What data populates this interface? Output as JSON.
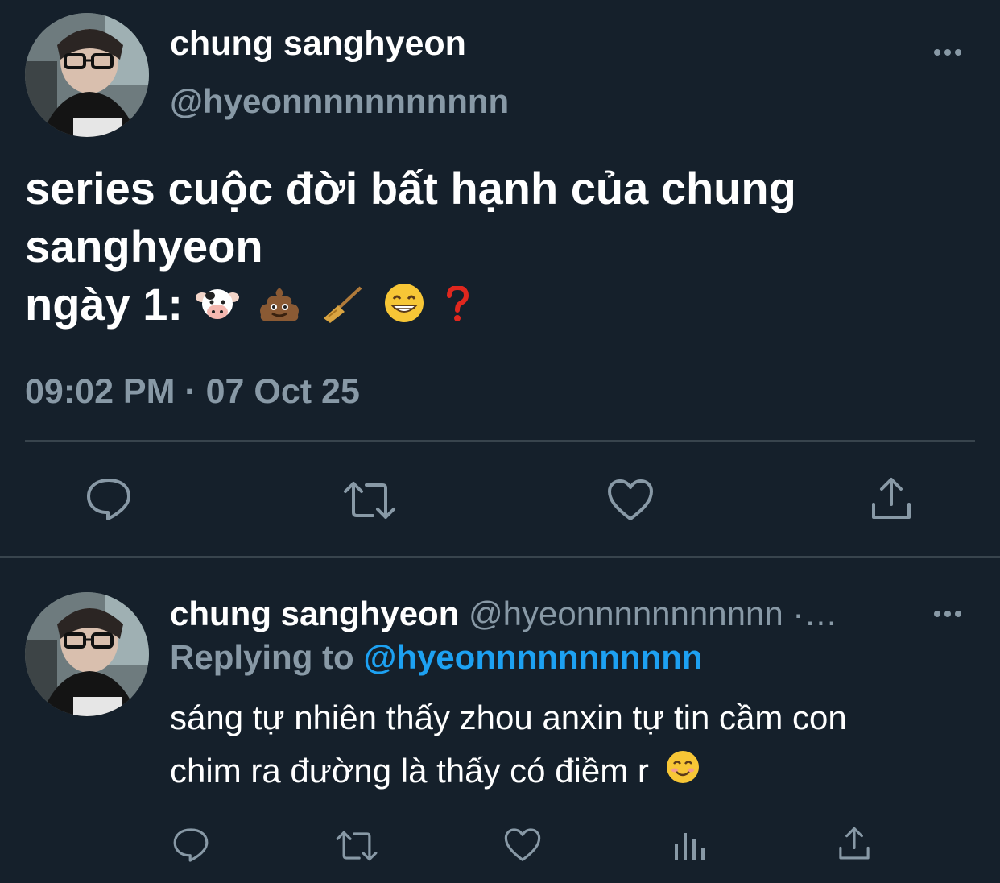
{
  "tweet": {
    "display_name": "chung sanghyeon",
    "handle": "@hyeonnnnnnnnnnn",
    "text_line1": "series cuộc đời bất hạnh của chung",
    "text_line2": "sanghyeon",
    "text_line3_prefix": "ngày 1:",
    "emojis": [
      "cow-face",
      "pile-of-poo",
      "broom",
      "grinning-face",
      "red-question-mark"
    ],
    "timestamp": "09:02 PM · 07 Oct 25"
  },
  "reply": {
    "display_name": "chung sanghyeon",
    "handle_and_time": "@hyeonnnnnnnnnnn ·…",
    "replying_label": "Replying to",
    "replying_mention": "@hyeonnnnnnnnnnn",
    "text_line1": "sáng tự nhiên thấy zhou anxin tự tin cầm con",
    "text_line2": "chim ra đường là thấy có điềm r",
    "emoji": "smiling-face"
  },
  "colors": {
    "background": "#15202b",
    "text": "#ffffff",
    "muted": "#8899a6",
    "accent": "#1da1f2",
    "divider": "#38444d"
  }
}
